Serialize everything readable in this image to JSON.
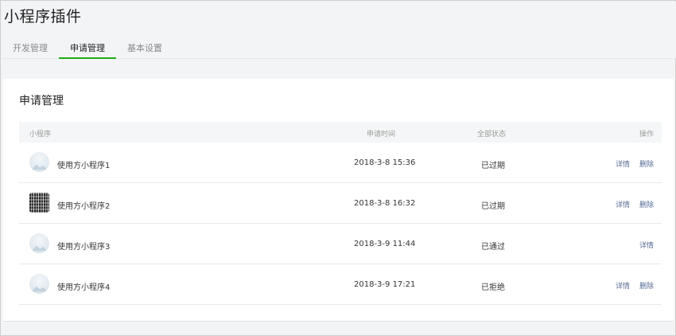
{
  "page": {
    "title": "小程序插件"
  },
  "tabs": [
    {
      "label": "开发管理",
      "active": false
    },
    {
      "label": "申请管理",
      "active": true
    },
    {
      "label": "基本设置",
      "active": false
    }
  ],
  "card": {
    "title": "申请管理"
  },
  "table": {
    "columns": {
      "name": "小程序",
      "time": "申请时间",
      "status": "全部状态",
      "ops": "操作"
    },
    "rows": [
      {
        "avatar": "mountain-placeholder-icon",
        "name": "使用方小程序1",
        "time": "2018-3-8 15:36",
        "status": "已过期",
        "detail": "详情",
        "delete": "删除"
      },
      {
        "avatar": "qr-code-icon",
        "name": "使用方小程序2",
        "time": "2018-3-8 16:32",
        "status": "已过期",
        "detail": "详情",
        "delete": "删除"
      },
      {
        "avatar": "mountain-placeholder-icon",
        "name": "使用方小程序3",
        "time": "2018-3-9 11:44",
        "status": "已通过",
        "detail": "详情"
      },
      {
        "avatar": "mountain-placeholder-icon",
        "name": "使用方小程序4",
        "time": "2018-3-9 17:21",
        "status": "已拒绝",
        "detail": "详情",
        "delete": "删除"
      }
    ]
  },
  "colors": {
    "accent": "#1aad19",
    "link": "#576b95"
  }
}
